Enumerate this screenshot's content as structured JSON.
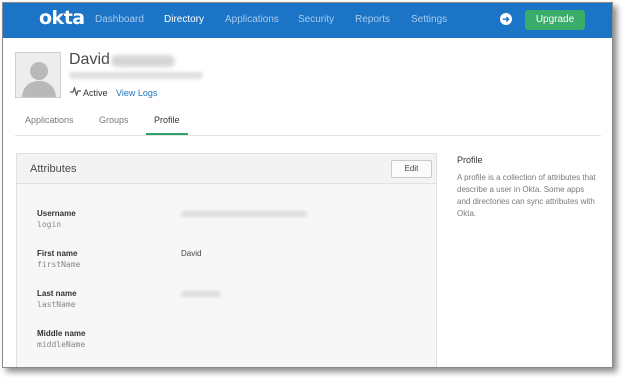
{
  "nav": {
    "logo": "okta",
    "items": [
      {
        "label": "Dashboard",
        "active": false
      },
      {
        "label": "Directory",
        "active": true
      },
      {
        "label": "Applications",
        "active": false
      },
      {
        "label": "Security",
        "active": false
      },
      {
        "label": "Reports",
        "active": false
      },
      {
        "label": "Settings",
        "active": false
      }
    ],
    "arrow_icon": "arrow-right-circle-icon",
    "upgrade_label": "Upgrade"
  },
  "profile": {
    "first_name": "David",
    "status_icon": "activity-pulse-icon",
    "status": "Active",
    "view_logs_label": "View Logs"
  },
  "tabs": [
    {
      "label": "Applications",
      "active": false
    },
    {
      "label": "Groups",
      "active": false
    },
    {
      "label": "Profile",
      "active": true
    }
  ],
  "attributes": {
    "title": "Attributes",
    "edit_label": "Edit",
    "rows": [
      {
        "label": "Username",
        "var": "login",
        "value": ""
      },
      {
        "label": "First name",
        "var": "firstName",
        "value": "David"
      },
      {
        "label": "Last name",
        "var": "lastName",
        "value": ""
      },
      {
        "label": "Middle name",
        "var": "middleName",
        "value": ""
      }
    ]
  },
  "help": {
    "title": "Profile",
    "text": "A profile is a collection of attributes that describe a user in Okta. Some apps and directories can sync attributes with Okta."
  },
  "colors": {
    "nav_bg": "#1b74c5",
    "upgrade_bg": "#3aac6a",
    "tab_active_underline": "#2ea06a",
    "link": "#1b74c5"
  }
}
